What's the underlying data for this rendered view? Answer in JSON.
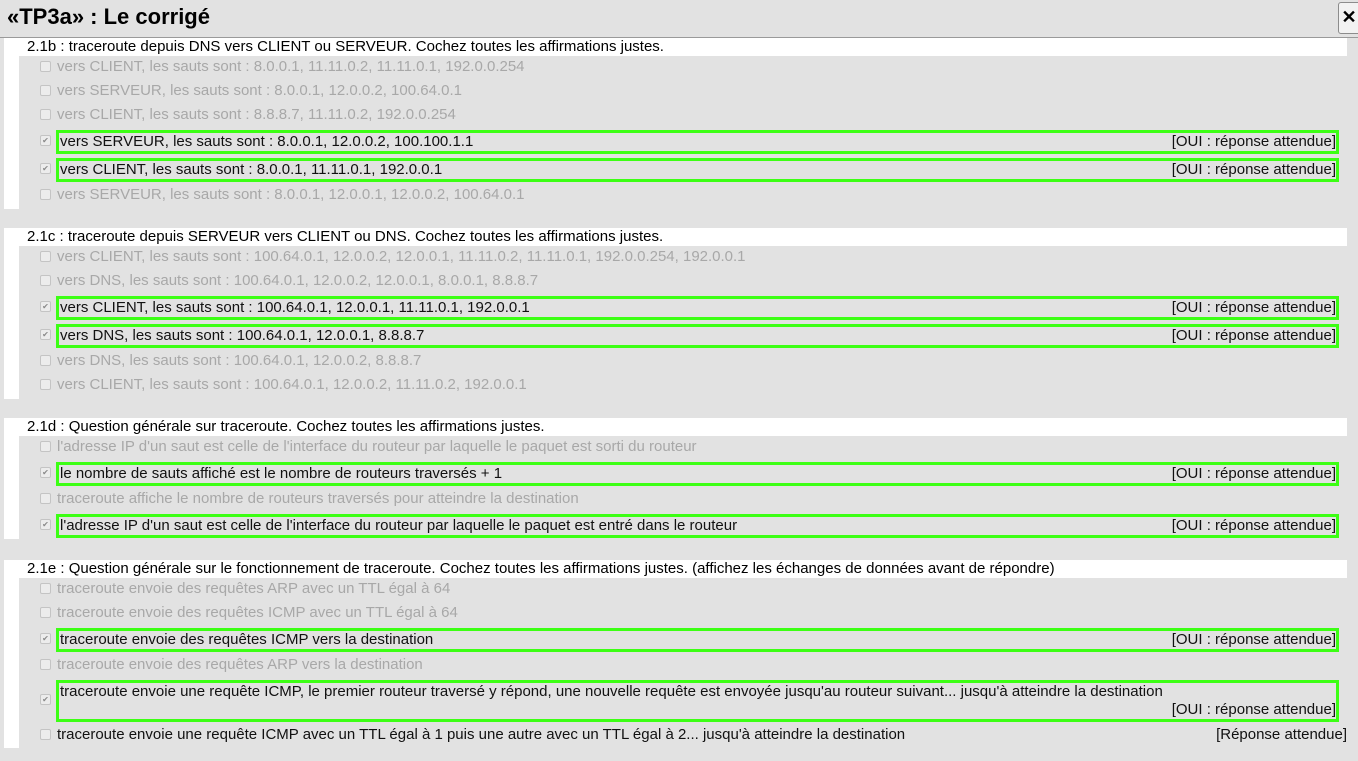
{
  "window": {
    "title": "«TP3a» : Le corrigé",
    "close_label": "✕"
  },
  "colors": {
    "correct_border": "#3cff14",
    "inactive_text": "#a8a8a8",
    "panel_bg": "#e2e2e2"
  },
  "sections": [
    {
      "title": "2.1b : traceroute depuis DNS vers CLIENT ou SERVEUR. Cochez toutes les affirmations justes.",
      "options": [
        {
          "text": "vers CLIENT, les sauts sont : 8.0.0.1, 11.11.0.2, 11.11.0.1, 192.0.0.254",
          "checked": false
        },
        {
          "text": "vers SERVEUR, les sauts sont : 8.0.0.1, 12.0.0.2, 100.64.0.1",
          "checked": false
        },
        {
          "text": "vers CLIENT, les sauts sont : 8.8.8.7, 11.11.0.2, 192.0.0.254",
          "checked": false
        },
        {
          "text": "vers SERVEUR, les sauts sont : 8.0.0.1, 12.0.0.2, 100.100.1.1",
          "checked": true,
          "verdict": "[OUI : réponse attendue]"
        },
        {
          "text": "vers CLIENT, les sauts sont : 8.0.0.1, 11.11.0.1, 192.0.0.1",
          "checked": true,
          "verdict": "[OUI : réponse attendue]"
        },
        {
          "text": "vers SERVEUR, les sauts sont : 8.0.0.1, 12.0.0.1, 12.0.0.2, 100.64.0.1",
          "checked": false
        }
      ]
    },
    {
      "title": "2.1c : traceroute depuis SERVEUR vers CLIENT ou DNS. Cochez toutes les affirmations justes.",
      "options": [
        {
          "text": "vers CLIENT, les sauts sont : 100.64.0.1, 12.0.0.2, 12.0.0.1, 11.11.0.2, 11.11.0.1, 192.0.0.254, 192.0.0.1",
          "checked": false
        },
        {
          "text": "vers DNS, les sauts sont : 100.64.0.1, 12.0.0.2, 12.0.0.1, 8.0.0.1, 8.8.8.7",
          "checked": false
        },
        {
          "text": "vers CLIENT, les sauts sont : 100.64.0.1, 12.0.0.1, 11.11.0.1, 192.0.0.1",
          "checked": true,
          "verdict": "[OUI : réponse attendue]"
        },
        {
          "text": "vers DNS, les sauts sont : 100.64.0.1, 12.0.0.1, 8.8.8.7",
          "checked": true,
          "verdict": "[OUI : réponse attendue]"
        },
        {
          "text": "vers DNS, les sauts sont : 100.64.0.1, 12.0.0.2, 8.8.8.7",
          "checked": false
        },
        {
          "text": "vers CLIENT, les sauts sont : 100.64.0.1, 12.0.0.2, 11.11.0.2, 192.0.0.1",
          "checked": false
        }
      ]
    },
    {
      "title": "2.1d : Question générale sur traceroute. Cochez toutes les affirmations justes.",
      "options": [
        {
          "text": "l'adresse IP d'un saut est celle de l'interface du routeur par laquelle le paquet est sorti du routeur",
          "checked": false
        },
        {
          "text": "le nombre de sauts affiché est le nombre de routeurs traversés + 1",
          "checked": true,
          "verdict": "[OUI : réponse attendue]"
        },
        {
          "text": "traceroute affiche le nombre de routeurs traversés pour atteindre la destination",
          "checked": false
        },
        {
          "text": "l'adresse IP d'un saut est celle de l'interface du routeur par laquelle le paquet est entré dans le routeur",
          "checked": true,
          "verdict": "[OUI : réponse attendue]"
        }
      ]
    },
    {
      "title": "2.1e : Question générale sur le fonctionnement de traceroute. Cochez toutes les affirmations justes. (affichez les échanges de données avant de répondre)",
      "options": [
        {
          "text": "traceroute envoie des requêtes ARP avec un TTL égal à 64",
          "checked": false
        },
        {
          "text": "traceroute envoie des requêtes ICMP avec un TTL égal à 64",
          "checked": false
        },
        {
          "text": "traceroute envoie des requêtes ICMP vers la destination",
          "checked": true,
          "verdict": "[OUI : réponse attendue]"
        },
        {
          "text": "traceroute envoie des requêtes ARP vers la destination",
          "checked": false
        },
        {
          "text": "traceroute envoie une requête ICMP, le premier routeur traversé y répond, une nouvelle requête est envoyée jusqu'au routeur suivant... jusqu'à atteindre la destination",
          "checked": true,
          "verdict": "[OUI : réponse attendue]"
        },
        {
          "text": "traceroute envoie une requête ICMP avec un TTL égal à 1 puis une autre avec un TTL égal à 2... jusqu'à atteindre la destination",
          "checked": false,
          "verdict": "[Réponse attendue]"
        }
      ]
    }
  ]
}
